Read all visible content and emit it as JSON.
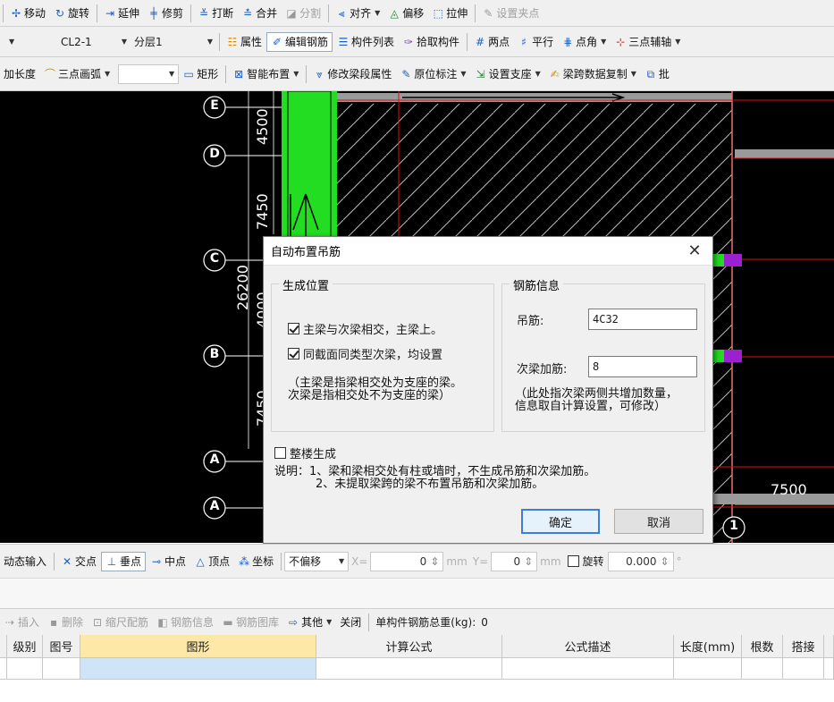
{
  "toolbar1": {
    "items": [
      {
        "icon": "move-icon",
        "label": "移动",
        "enabled": true
      },
      {
        "icon": "rotate-icon",
        "label": "旋转",
        "enabled": true
      },
      {
        "icon": "extend-icon",
        "label": "延伸",
        "enabled": true
      },
      {
        "icon": "trim-icon",
        "label": "修剪",
        "enabled": true
      },
      {
        "icon": "break-icon",
        "label": "打断",
        "enabled": true
      },
      {
        "icon": "merge-icon",
        "label": "合并",
        "enabled": true
      },
      {
        "icon": "split-icon",
        "label": "分割",
        "enabled": false
      },
      {
        "icon": "align-icon",
        "label": "对齐",
        "enabled": true
      },
      {
        "icon": "offset-icon",
        "label": "偏移",
        "enabled": true
      },
      {
        "icon": "stretch-icon",
        "label": "拉伸",
        "enabled": true
      },
      {
        "icon": "grip-icon",
        "label": "设置夹点",
        "enabled": false
      }
    ]
  },
  "toolbar2": {
    "member_select": "CL2-1",
    "layer_select": "分层1",
    "items": [
      {
        "icon": "property-icon",
        "label": "属性"
      },
      {
        "icon": "edit-rebar-icon",
        "label": "编辑钢筋"
      },
      {
        "icon": "member-list-icon",
        "label": "构件列表"
      },
      {
        "icon": "pick-member-icon",
        "label": "拾取构件"
      },
      {
        "icon": "two-points-icon",
        "label": "两点"
      },
      {
        "icon": "parallel-icon",
        "label": "平行"
      },
      {
        "icon": "point-angle-icon",
        "label": "点角"
      },
      {
        "icon": "three-point-axis-icon",
        "label": "三点辅轴"
      }
    ]
  },
  "toolbar3": {
    "items": [
      {
        "icon": "length-icon",
        "label": "加长度"
      },
      {
        "icon": "arc-icon",
        "label": "三点画弧"
      },
      {
        "icon": "rect-icon",
        "label": "矩形"
      },
      {
        "icon": "smart-layout-icon",
        "label": "智能布置"
      },
      {
        "icon": "modify-beam-icon",
        "label": "修改梁段属性"
      },
      {
        "icon": "in-situ-mark-icon",
        "label": "原位标注"
      },
      {
        "icon": "support-icon",
        "label": "设置支座"
      },
      {
        "icon": "copy-span-icon",
        "label": "梁跨数据复制"
      },
      {
        "icon": "batch-icon",
        "label": "批"
      }
    ]
  },
  "canvas": {
    "axis_labels": [
      "E",
      "D",
      "C",
      "B",
      "A",
      "A"
    ],
    "axis_label_bottom": "1",
    "dims_vertical": [
      "4500",
      "7450",
      "26200",
      "4000",
      "7450"
    ],
    "dim_horizontal": "7500"
  },
  "dialog": {
    "title": "自动布置吊筋",
    "group_position": {
      "legend": "生成位置",
      "chk1_label": "主梁与次梁相交，主梁上。",
      "chk1_checked": true,
      "chk2_label": "同截面同类型次梁，均设置",
      "chk2_checked": true,
      "note_line1": "（主梁是指梁相交处为支座的梁。",
      "note_line2": "次梁是指相交处不为支座的梁）"
    },
    "group_rebar": {
      "legend": "钢筋信息",
      "hanger_label": "吊筋:",
      "hanger_value": "4C32",
      "secondary_label": "次梁加筋:",
      "secondary_value": "8",
      "note_line1": "（此处指次梁两侧共增加数量，",
      "note_line2": "信息取自计算设置，可修改）"
    },
    "whole_building_label": "整楼生成",
    "whole_building_checked": false,
    "desc_line1": "说明：1、梁和梁相交处有柱或墙时，不生成吊筋和次梁加筋。",
    "desc_line2": "2、未提取梁跨的梁不布置吊筋和次梁加筋。",
    "ok_label": "确定",
    "cancel_label": "取消"
  },
  "statusbar": {
    "dynamic_input": "动态输入",
    "snap_items": [
      {
        "icon": "intersection-icon",
        "label": "交点"
      },
      {
        "icon": "perpendicular-icon",
        "label": "垂点"
      },
      {
        "icon": "midpoint-icon",
        "label": "中点"
      },
      {
        "icon": "vertex-icon",
        "label": "顶点"
      },
      {
        "icon": "coordinate-icon",
        "label": "坐标"
      }
    ],
    "offset_mode": "不偏移",
    "x_label": "X=",
    "x_value": "0",
    "x_unit": "mm",
    "y_label": "Y=",
    "y_value": "0",
    "y_unit": "mm",
    "rotate_label": "旋转",
    "rotate_value": "0.000",
    "rotate_unit": "°"
  },
  "rebar_toolbar": {
    "insert": "插入",
    "delete": "删除",
    "scale_rebar": "缩尺配筋",
    "rebar_info": "钢筋信息",
    "rebar_library": "钢筋图库",
    "other": "其他",
    "close": "关闭",
    "total_weight_label": "单构件钢筋总重(kg):",
    "total_weight_value": "0"
  },
  "grid": {
    "headers": [
      "级别",
      "图号",
      "图形",
      "计算公式",
      "公式描述",
      "长度(mm)",
      "根数",
      "搭接"
    ]
  },
  "colors": {
    "canvas_bg": "#000000",
    "column_green": "#22dd22",
    "grid_red": "#e01010",
    "beam_purple": "#9a20d0",
    "dialog_bg": "#f0f0f0",
    "header_selected": "#fde8a8"
  }
}
